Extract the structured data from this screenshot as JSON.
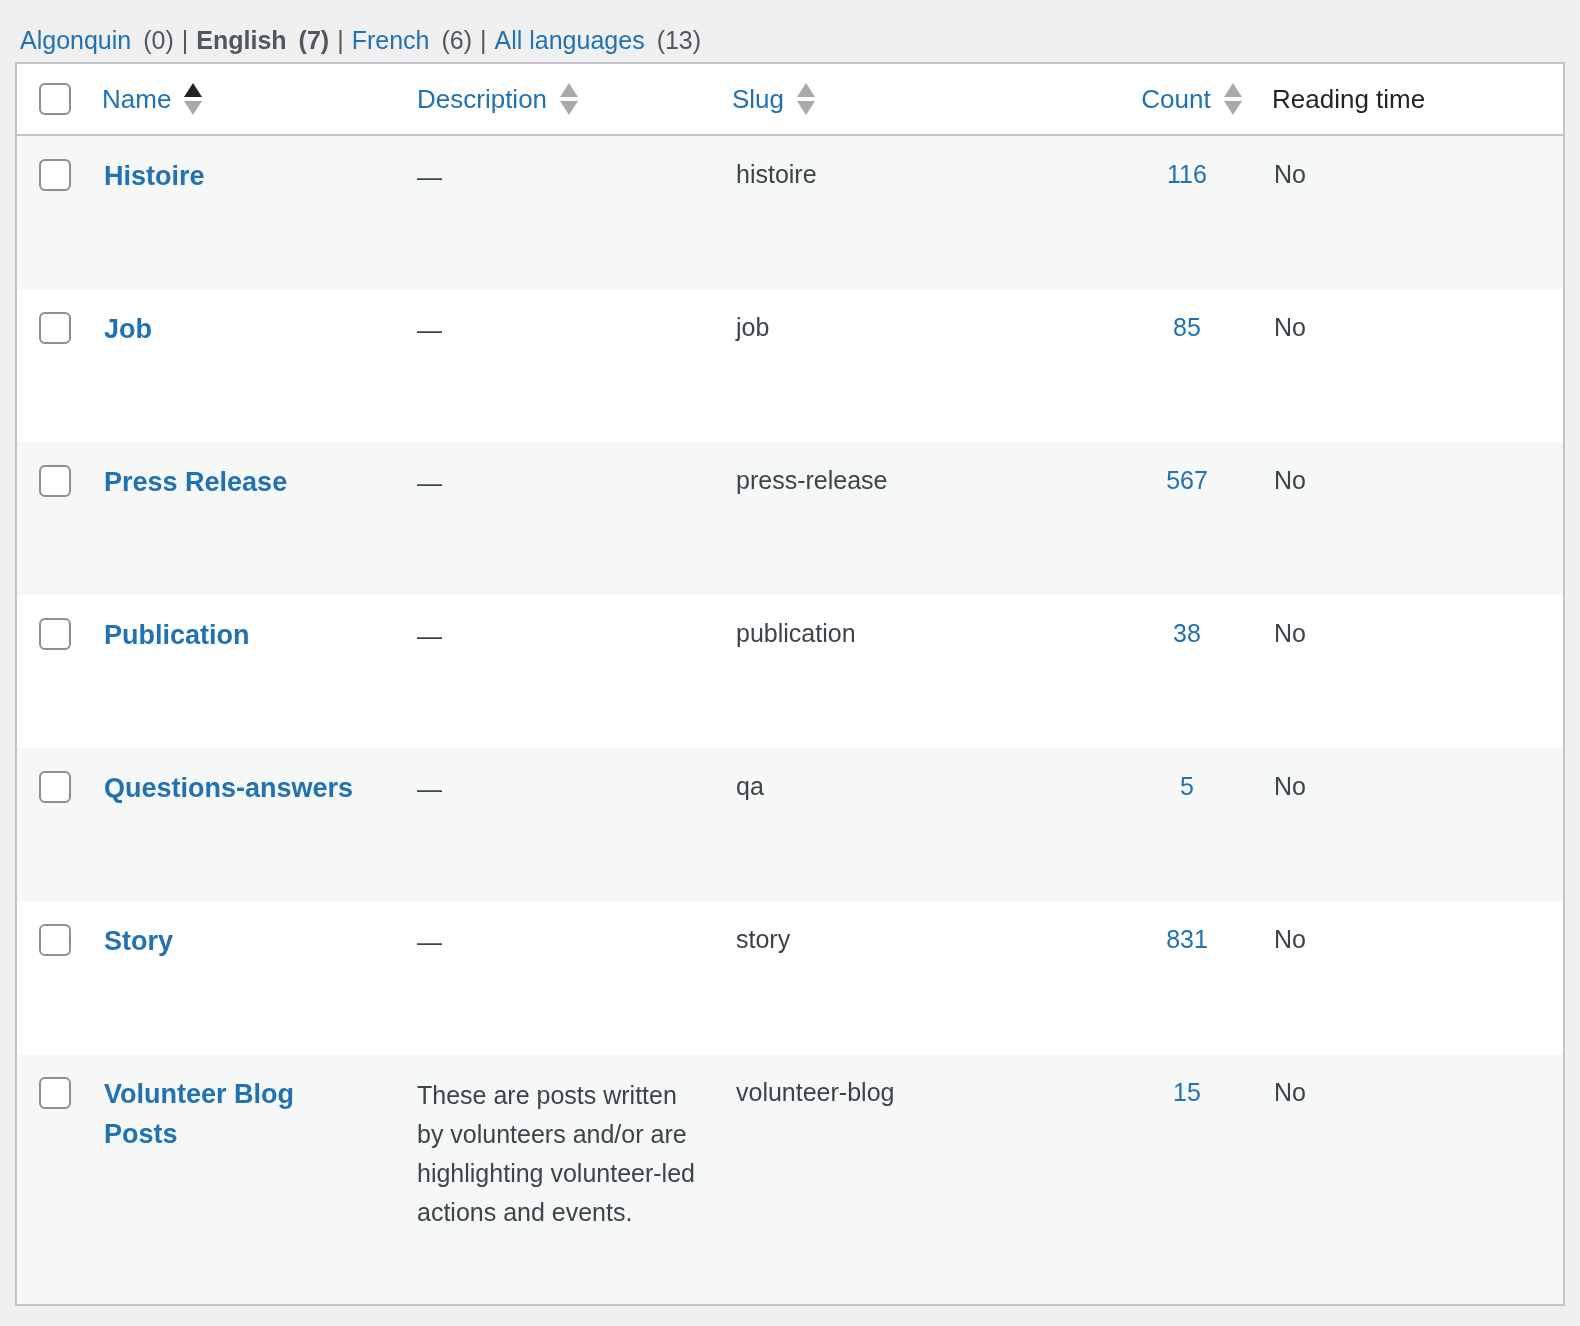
{
  "language_filter": [
    {
      "label": "Algonquin",
      "count": "(0)",
      "selected": false
    },
    {
      "label": "English",
      "count": "(7)",
      "selected": true
    },
    {
      "label": "French",
      "count": "(6)",
      "selected": false
    },
    {
      "label": "All languages",
      "count": "(13)",
      "selected": false
    }
  ],
  "separator": "|",
  "table": {
    "select_all": {
      "checked": false
    },
    "columns": [
      {
        "label": "Name",
        "sortable": true,
        "sorted": true
      },
      {
        "label": "Description",
        "sortable": true,
        "sorted": false
      },
      {
        "label": "Slug",
        "sortable": true,
        "sorted": false
      },
      {
        "label": "Count",
        "sortable": true,
        "sorted": false
      },
      {
        "label": "Reading time",
        "sortable": false
      }
    ],
    "rows": [
      {
        "checked": false,
        "name": "Histoire",
        "description": "—",
        "slug": "histoire",
        "count": "116",
        "reading_time": "No"
      },
      {
        "checked": false,
        "name": "Job",
        "description": "—",
        "slug": "job",
        "count": "85",
        "reading_time": "No"
      },
      {
        "checked": false,
        "name": "Press Release",
        "description": "—",
        "slug": "press-release",
        "count": "567",
        "reading_time": "No"
      },
      {
        "checked": false,
        "name": "Publication",
        "description": "—",
        "slug": "publication",
        "count": "38",
        "reading_time": "No"
      },
      {
        "checked": false,
        "name": "Questions-answers",
        "description": "—",
        "slug": "qa",
        "count": "5",
        "reading_time": "No"
      },
      {
        "checked": false,
        "name": "Story",
        "description": "—",
        "slug": "story",
        "count": "831",
        "reading_time": "No"
      },
      {
        "checked": false,
        "name": "Volunteer Blog Posts",
        "description": "These are posts written by volunteers and/or are highlighting volunteer-led actions and events.",
        "slug": "volunteer-blog",
        "count": "15",
        "reading_time": "No"
      }
    ]
  }
}
